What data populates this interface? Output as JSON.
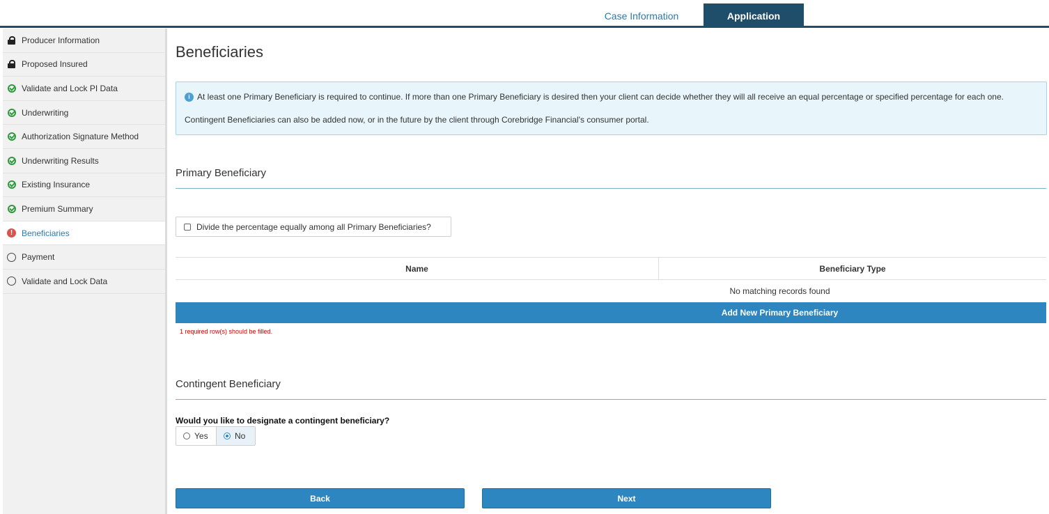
{
  "tabs": {
    "case_information": "Case Information",
    "application": "Application"
  },
  "sidebar": {
    "items": [
      {
        "label": "Producer Information",
        "icon": "lock-icon",
        "status": "locked"
      },
      {
        "label": "Proposed Insured",
        "icon": "lock-icon",
        "status": "locked"
      },
      {
        "label": "Validate and Lock PI Data",
        "icon": "check-circle-icon",
        "status": "complete"
      },
      {
        "label": "Underwriting",
        "icon": "check-circle-icon",
        "status": "complete"
      },
      {
        "label": "Authorization Signature Method",
        "icon": "check-circle-icon",
        "status": "complete"
      },
      {
        "label": "Underwriting Results",
        "icon": "check-circle-icon",
        "status": "complete"
      },
      {
        "label": "Existing Insurance",
        "icon": "check-circle-icon",
        "status": "complete"
      },
      {
        "label": "Premium Summary",
        "icon": "check-circle-icon",
        "status": "complete"
      },
      {
        "label": "Beneficiaries",
        "icon": "alert-circle-icon",
        "status": "error"
      },
      {
        "label": "Payment",
        "icon": "empty-circle-icon",
        "status": "incomplete"
      },
      {
        "label": "Validate and Lock Data",
        "icon": "empty-circle-icon",
        "status": "incomplete"
      }
    ]
  },
  "main": {
    "title": "Beneficiaries",
    "info": {
      "line1": "At least one Primary Beneficiary is required to continue. If more than one Primary Beneficiary is desired then your client can decide whether they will all receive an equal percentage or specified percentage for each one.",
      "line2": "Contingent Beneficiaries can also be added now, or in the future by the client through Corebridge Financial's consumer portal."
    },
    "primary": {
      "title": "Primary Beneficiary",
      "divide_label": "Divide the percentage equally among all Primary Beneficiaries?",
      "columns": [
        "Name",
        "Beneficiary Type"
      ],
      "empty_message": "No matching records found",
      "add_button": "Add New Primary Beneficiary",
      "required_message": "1 required row(s) should be filled."
    },
    "contingent": {
      "title": "Contingent Beneficiary",
      "question": "Would you like to designate a contingent beneficiary?",
      "options": [
        "Yes",
        "No"
      ],
      "selected": "No"
    },
    "buttons": {
      "back": "Back",
      "next": "Next"
    }
  },
  "colors": {
    "primary_blue": "#2d86bf",
    "dark_navy": "#1f4e6b",
    "error_red": "#d9534f",
    "success_green": "#2e9b3e"
  }
}
